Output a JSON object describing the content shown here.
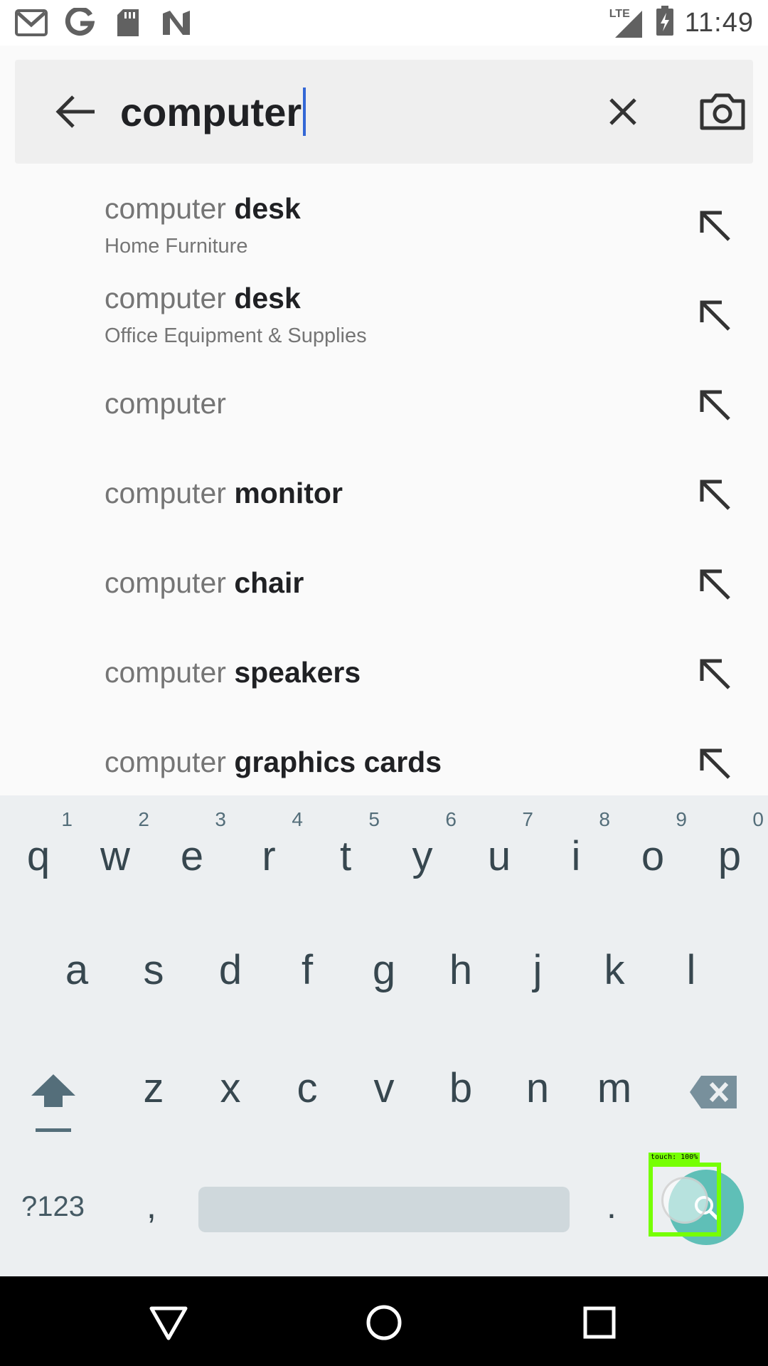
{
  "status_bar": {
    "time": "11:49",
    "network": "LTE",
    "left_icons": [
      "gmail-icon",
      "google-icon",
      "sd-card-icon",
      "n-icon"
    ]
  },
  "search": {
    "query": "computer"
  },
  "suggestions": [
    {
      "prefix": "computer",
      "bold": "desk",
      "category": "Home Furniture"
    },
    {
      "prefix": "computer",
      "bold": "desk",
      "category": "Office Equipment & Supplies"
    },
    {
      "prefix": "computer",
      "bold": "",
      "category": ""
    },
    {
      "prefix": "computer",
      "bold": "monitor",
      "category": ""
    },
    {
      "prefix": "computer",
      "bold": "chair",
      "category": ""
    },
    {
      "prefix": "computer",
      "bold": "speakers",
      "category": ""
    },
    {
      "prefix": "computer",
      "bold": "graphics cards",
      "category": ""
    }
  ],
  "keyboard": {
    "row1": [
      {
        "key": "q",
        "hint": "1"
      },
      {
        "key": "w",
        "hint": "2"
      },
      {
        "key": "e",
        "hint": "3"
      },
      {
        "key": "r",
        "hint": "4"
      },
      {
        "key": "t",
        "hint": "5"
      },
      {
        "key": "y",
        "hint": "6"
      },
      {
        "key": "u",
        "hint": "7"
      },
      {
        "key": "i",
        "hint": "8"
      },
      {
        "key": "o",
        "hint": "9"
      },
      {
        "key": "p",
        "hint": "0"
      }
    ],
    "row2": [
      "a",
      "s",
      "d",
      "f",
      "g",
      "h",
      "j",
      "k",
      "l"
    ],
    "row3": [
      "z",
      "x",
      "c",
      "v",
      "b",
      "n",
      "m"
    ],
    "symbols_label": "?123",
    "comma": ",",
    "period": "."
  },
  "touch_indicator": "touch: 100%"
}
